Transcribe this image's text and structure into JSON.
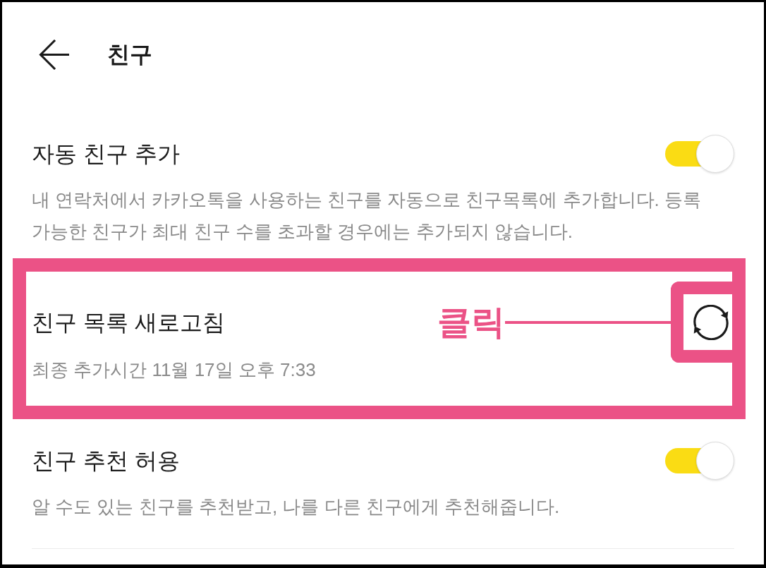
{
  "header": {
    "title": "친구"
  },
  "settings": [
    {
      "kind": "toggle",
      "title": "자동 친구 추가",
      "description": "내 연락처에서 카카오톡을 사용하는 친구를 자동으로 친구목록에 추가합니다. 등록 가능한 친구가 최대 친구 수를 초과할 경우에는 추가되지 않습니다.",
      "on": true,
      "highlighted": false
    },
    {
      "kind": "refresh",
      "title": "친구 목록 새로고침",
      "description": "최종 추가시간 11월 17일 오후 7:33",
      "highlighted": true,
      "callout": "클릭"
    },
    {
      "kind": "toggle",
      "title": "친구 추천 허용",
      "description": "알 수도 있는 친구를 추천받고, 나를 다른 친구에게 추천해줍니다.",
      "on": true,
      "highlighted": false
    }
  ]
}
